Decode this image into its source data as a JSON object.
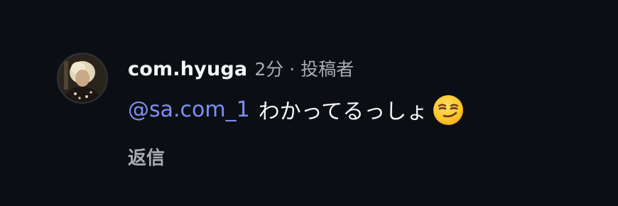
{
  "comment": {
    "username": "com.hyuga",
    "time": "2分",
    "separator": "·",
    "role_badge": "投稿者",
    "mention": "@sa.com_1",
    "text": "わかってるっしょ",
    "emoji": "smirking-face-emoji",
    "reply_label": "返信"
  },
  "colors": {
    "background": "#0b0f14",
    "username": "#f5f6f7",
    "meta": "#a9adb3",
    "mention": "#7d8ff5"
  }
}
